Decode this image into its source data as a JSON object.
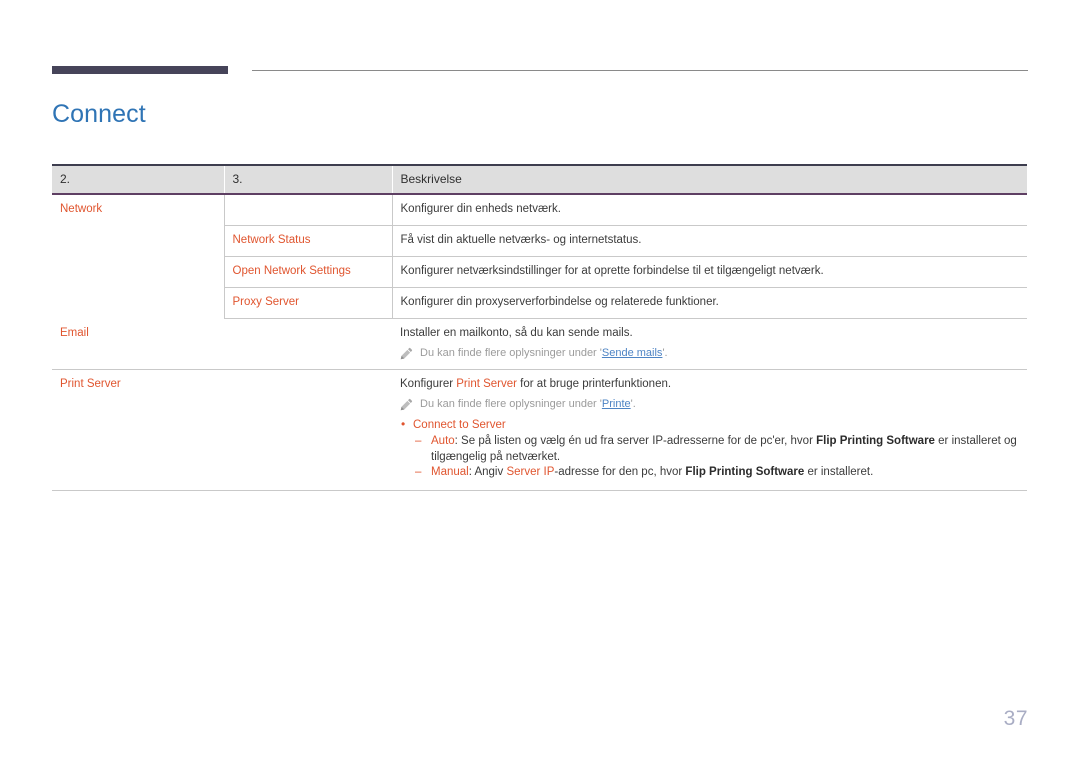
{
  "document": {
    "title": "Connect",
    "page_number": "37"
  },
  "table": {
    "headers": [
      "2.",
      "3.",
      "Beskrivelse"
    ],
    "rows": [
      {
        "col1": "Network",
        "col2": "",
        "desc": "Konfigurer din enheds netværk."
      },
      {
        "col1": "",
        "col2": "Network Status",
        "desc": "Få vist din aktuelle netværks- og internetstatus."
      },
      {
        "col1": "",
        "col2": "Open Network Settings",
        "desc": "Konfigurer netværksindstillinger for at oprette forbindelse til et tilgængeligt netværk."
      },
      {
        "col1": "",
        "col2": "Proxy Server",
        "desc": "Konfigurer din proxyserverforbindelse og relaterede funktioner."
      }
    ],
    "email_row": {
      "col1": "Email",
      "desc": "Installer en mailkonto, så du kan sende mails.",
      "note_prefix": "Du kan finde flere oplysninger under '",
      "note_link": "Sende mails",
      "note_suffix": "'."
    },
    "print_server_row": {
      "col1": "Print Server",
      "desc_pre": "Konfigurer ",
      "desc_term": "Print Server",
      "desc_post": " for at bruge printerfunktionen.",
      "note_prefix": "Du kan finde flere oplysninger under '",
      "note_link": "Printe",
      "note_suffix": "'.",
      "bullet_label": "Connect to Server",
      "sub_items": [
        {
          "term": "Auto",
          "text_1": ": Se på listen og vælg én ud fra server IP-adresserne for de pc'er, hvor ",
          "bold_1": "Flip Printing Software",
          "text_2": " er installeret og tilgængelig på netværket."
        },
        {
          "term": "Manual",
          "text_1": ": Angiv ",
          "term_2": "Server IP",
          "text_2": "-adresse for den pc, hvor ",
          "bold_1": "Flip Printing Software",
          "text_3": " er installeret."
        }
      ]
    }
  },
  "icons": {
    "note_icon": "pencil-icon"
  },
  "colors": {
    "title_blue": "#2f74b5",
    "accent_orange": "#e0552f",
    "link_blue": "#4e84c4",
    "header_bar_dark": "#464459",
    "page_number_gray": "#a9adc4"
  }
}
